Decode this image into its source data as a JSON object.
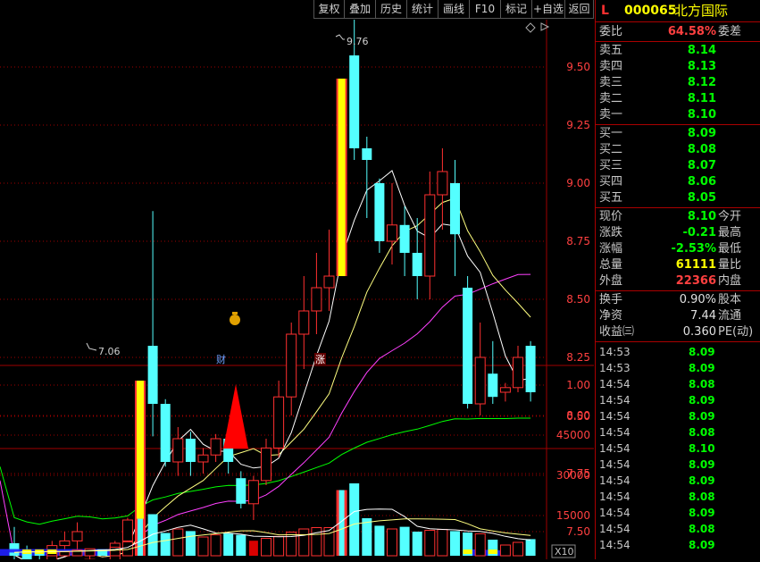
{
  "toolbar": {
    "buttons": [
      "复权",
      "叠加",
      "历史",
      "统计",
      "画线",
      "F10",
      "标记",
      "+自选",
      "返回"
    ]
  },
  "chart_data": {
    "type": "candlestick",
    "y_ticks": [
      "9.50",
      "9.25",
      "9.00",
      "8.75",
      "8.50",
      "8.25",
      "8.00",
      "7.75",
      "7.50"
    ],
    "high_label": "9.76",
    "low_label": "7.06",
    "markers": [
      "财",
      "涨"
    ],
    "mid_ticks": [
      "1.00",
      "0.50"
    ],
    "vol_ticks": [
      "45000",
      "30000",
      "15000"
    ],
    "vol_unit": "X10",
    "candles": [
      {
        "o": 7.45,
        "h": 7.52,
        "l": 7.35,
        "c": 7.4
      },
      {
        "o": 7.4,
        "h": 7.44,
        "l": 7.33,
        "c": 7.34
      },
      {
        "o": 7.35,
        "h": 7.4,
        "l": 7.3,
        "c": 7.32
      },
      {
        "o": 7.32,
        "h": 7.46,
        "l": 7.3,
        "c": 7.44
      },
      {
        "o": 7.44,
        "h": 7.5,
        "l": 7.4,
        "c": 7.46
      },
      {
        "o": 7.46,
        "h": 7.54,
        "l": 7.42,
        "c": 7.5
      },
      {
        "o": 7.38,
        "h": 7.4,
        "l": 7.26,
        "c": 7.38
      },
      {
        "o": 7.34,
        "h": 7.36,
        "l": 7.25,
        "c": 7.29
      },
      {
        "o": 7.35,
        "h": 7.46,
        "l": 7.32,
        "c": 7.45
      },
      {
        "o": 7.46,
        "h": 7.56,
        "l": 7.45,
        "c": 7.55
      },
      {
        "o": 7.45,
        "h": 8.15,
        "l": 7.45,
        "c": 8.15,
        "limit": true
      },
      {
        "o": 8.3,
        "h": 8.88,
        "l": 7.91,
        "c": 8.05
      },
      {
        "o": 8.05,
        "h": 8.07,
        "l": 7.78,
        "c": 7.8
      },
      {
        "o": 7.8,
        "h": 7.95,
        "l": 7.74,
        "c": 7.9
      },
      {
        "o": 7.9,
        "h": 7.93,
        "l": 7.74,
        "c": 7.8
      },
      {
        "o": 7.8,
        "h": 7.86,
        "l": 7.75,
        "c": 7.83
      },
      {
        "o": 7.83,
        "h": 7.92,
        "l": 7.8,
        "c": 7.9
      },
      {
        "o": 7.9,
        "h": 7.92,
        "l": 7.75,
        "c": 7.8
      },
      {
        "o": 7.73,
        "h": 7.76,
        "l": 7.6,
        "c": 7.62
      },
      {
        "o": 7.62,
        "h": 7.74,
        "l": 7.55,
        "c": 7.72
      },
      {
        "o": 7.72,
        "h": 7.9,
        "l": 7.7,
        "c": 7.86
      },
      {
        "o": 7.86,
        "h": 8.15,
        "l": 7.82,
        "c": 8.08
      },
      {
        "o": 8.08,
        "h": 8.4,
        "l": 8.0,
        "c": 8.35
      },
      {
        "o": 8.35,
        "h": 8.6,
        "l": 8.2,
        "c": 8.45
      },
      {
        "o": 8.45,
        "h": 8.7,
        "l": 8.35,
        "c": 8.55
      },
      {
        "o": 8.55,
        "h": 8.8,
        "l": 8.45,
        "c": 8.6
      },
      {
        "o": 8.6,
        "h": 9.45,
        "l": 8.6,
        "c": 9.45,
        "limit": true
      },
      {
        "o": 9.55,
        "h": 9.76,
        "l": 9.1,
        "c": 9.15
      },
      {
        "o": 9.15,
        "h": 9.2,
        "l": 8.85,
        "c": 9.1
      },
      {
        "o": 9.0,
        "h": 9.02,
        "l": 8.7,
        "c": 8.75
      },
      {
        "o": 8.75,
        "h": 9.0,
        "l": 8.65,
        "c": 8.82
      },
      {
        "o": 8.82,
        "h": 8.9,
        "l": 8.6,
        "c": 8.7
      },
      {
        "o": 8.7,
        "h": 8.85,
        "l": 8.5,
        "c": 8.6
      },
      {
        "o": 8.6,
        "h": 9.05,
        "l": 8.5,
        "c": 8.95
      },
      {
        "o": 8.95,
        "h": 9.15,
        "l": 8.8,
        "c": 9.05
      },
      {
        "o": 9.0,
        "h": 9.1,
        "l": 8.6,
        "c": 8.78
      },
      {
        "o": 8.55,
        "h": 8.6,
        "l": 8.03,
        "c": 8.05
      },
      {
        "o": 8.05,
        "h": 8.4,
        "l": 8.0,
        "c": 8.25
      },
      {
        "o": 8.18,
        "h": 8.32,
        "l": 8.05,
        "c": 8.08
      },
      {
        "o": 8.1,
        "h": 8.14,
        "l": 8.06,
        "c": 8.12
      },
      {
        "o": 8.12,
        "h": 8.3,
        "l": 8.1,
        "c": 8.25
      },
      {
        "o": 8.3,
        "h": 8.32,
        "l": 8.06,
        "c": 8.1
      }
    ],
    "volumes": [
      120,
      180,
      140,
      200,
      150,
      210,
      260,
      240,
      320,
      520,
      1380,
      1550,
      850,
      1000,
      920,
      700,
      780,
      830,
      780,
      560,
      650,
      720,
      880,
      1000,
      1050,
      1050,
      2450,
      2700,
      1400,
      1120,
      1000,
      1080,
      900,
      950,
      980,
      920,
      870,
      820,
      600,
      400,
      500,
      620
    ]
  },
  "panel": {
    "code_prefix": "L",
    "code": "000065",
    "name": "北方国际",
    "weibi_label": "委比",
    "weibi_value": "64.58%",
    "weicha_label": "委差",
    "asks": [
      {
        "label": "卖五",
        "price": "8.14"
      },
      {
        "label": "卖四",
        "price": "8.13"
      },
      {
        "label": "卖三",
        "price": "8.12"
      },
      {
        "label": "卖二",
        "price": "8.11"
      },
      {
        "label": "卖一",
        "price": "8.10"
      }
    ],
    "bids": [
      {
        "label": "买一",
        "price": "8.09"
      },
      {
        "label": "买二",
        "price": "8.08"
      },
      {
        "label": "买三",
        "price": "8.07"
      },
      {
        "label": "买四",
        "price": "8.06"
      },
      {
        "label": "买五",
        "price": "8.05"
      }
    ],
    "quote": {
      "xianjia_label": "现价",
      "xianjia": "8.10",
      "jinkai_label": "今开",
      "zhangdie_label": "涨跌",
      "zhangdie": "-0.21",
      "zuigao_label": "最高",
      "zhangfu_label": "涨幅",
      "zhangfu": "-2.53%",
      "zuidi_label": "最低",
      "zongliang_label": "总量",
      "zongliang": "61111",
      "liangbi_label": "量比",
      "waipan_label": "外盘",
      "waipan": "22366",
      "neipan_label": "内盘"
    },
    "fin": {
      "huanshou_label": "换手",
      "huanshou": "0.90%",
      "guben_label": "股本",
      "jingzi_label": "净资",
      "jingzi": "7.44",
      "liutong_label": "流通",
      "shouyi_label": "收益㈢",
      "shouyi": "0.360",
      "pe_label": "PE(动)"
    },
    "ticks": [
      {
        "time": "14:53",
        "price": "8.09"
      },
      {
        "time": "14:53",
        "price": "8.09"
      },
      {
        "time": "14:54",
        "price": "8.08"
      },
      {
        "time": "14:54",
        "price": "8.09"
      },
      {
        "time": "14:54",
        "price": "8.09"
      },
      {
        "time": "14:54",
        "price": "8.08"
      },
      {
        "time": "14:54",
        "price": "8.10"
      },
      {
        "time": "14:54",
        "price": "8.09"
      },
      {
        "time": "14:54",
        "price": "8.09"
      },
      {
        "time": "14:54",
        "price": "8.08"
      },
      {
        "time": "14:54",
        "price": "8.09"
      },
      {
        "time": "14:54",
        "price": "8.08"
      },
      {
        "time": "14:54",
        "price": "8.09"
      }
    ]
  },
  "colors": {
    "up": "#ff3030",
    "down": "#54ffff",
    "limit": "#ffff00",
    "ma5": "#ffffff",
    "ma10": "#ffff80",
    "ma20": "#ff40ff",
    "ma60": "#00ff00",
    "grid": "#a00000"
  }
}
